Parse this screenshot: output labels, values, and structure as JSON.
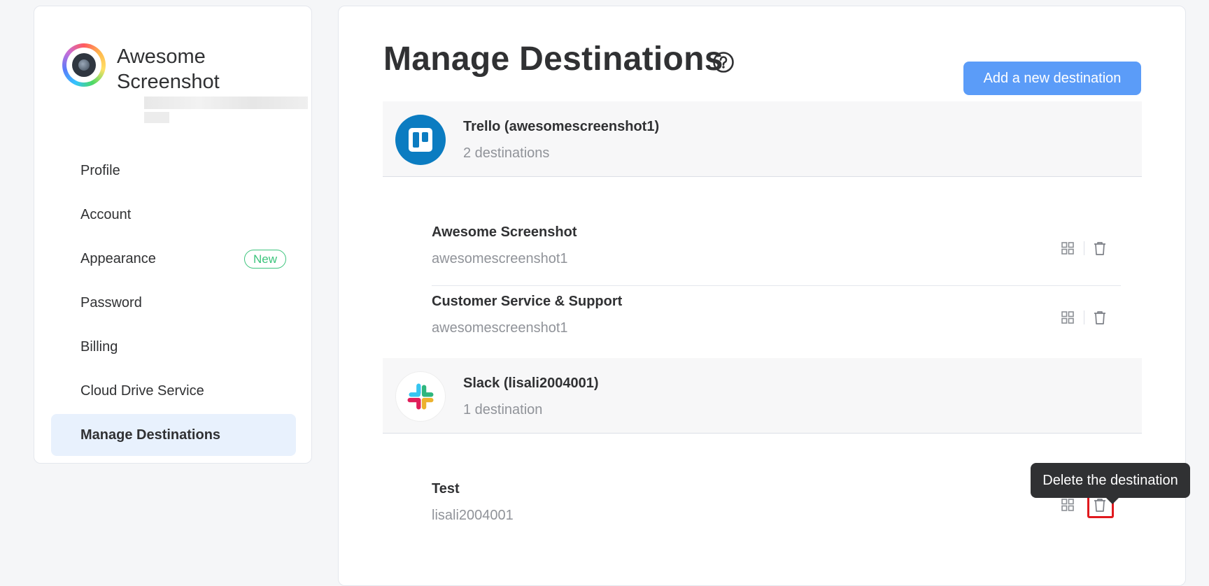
{
  "brand": {
    "name": "Awesome Screenshot"
  },
  "sidebar": {
    "items": [
      {
        "label": "Profile"
      },
      {
        "label": "Account"
      },
      {
        "label": "Appearance",
        "badge": "New"
      },
      {
        "label": "Password"
      },
      {
        "label": "Billing"
      },
      {
        "label": "Cloud Drive Service"
      },
      {
        "label": "Manage Destinations",
        "active": true
      }
    ]
  },
  "main": {
    "title": "Manage Destinations",
    "add_button": "Add a new destination",
    "groups": [
      {
        "provider": "Trello (awesomescreenshot1)",
        "count": "2 destinations",
        "icon": "trello-icon",
        "destinations": [
          {
            "name": "Awesome Screenshot",
            "account": "awesomescreenshot1"
          },
          {
            "name": "Customer Service & Support",
            "account": "awesomescreenshot1"
          }
        ]
      },
      {
        "provider": "Slack (lisali2004001)",
        "count": "1 destination",
        "icon": "slack-icon",
        "destinations": [
          {
            "name": "Test",
            "account": "lisali2004001"
          }
        ]
      }
    ],
    "tooltip": "Delete the destination"
  },
  "colors": {
    "accent": "#5b9cf8",
    "active_nav_bg": "#e8f1fd",
    "new_badge": "#3cc47c",
    "trello": "#0b7cc1",
    "highlight": "#e0191e"
  }
}
